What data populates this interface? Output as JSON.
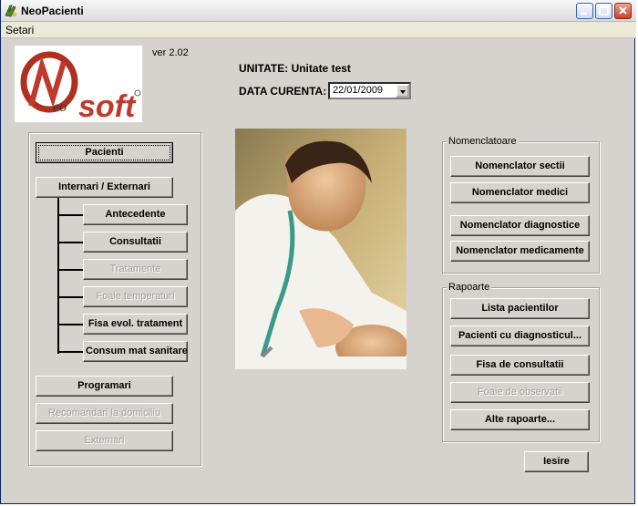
{
  "window": {
    "title": "NeoPacienti"
  },
  "menu": {
    "items": [
      "Setari"
    ]
  },
  "version_text": "ver 2.02",
  "unitate": {
    "label": "UNITATE:",
    "value": "Unitate test"
  },
  "data_curenta": {
    "label": "DATA CURENTA:",
    "value": "22/01/2009"
  },
  "left_panel": {
    "pacienti": "Pacienti",
    "internari_externari": "Internari / Externari",
    "sub_items": [
      {
        "label": "Antecedente",
        "enabled": true
      },
      {
        "label": "Consultatii",
        "enabled": true
      },
      {
        "label": "Tratamente",
        "enabled": false
      },
      {
        "label": "Foaie temperaturi",
        "enabled": false
      },
      {
        "label": "Fisa evol. tratament",
        "enabled": true
      },
      {
        "label": "Consum mat sanitare",
        "enabled": true
      }
    ],
    "programari": "Programari",
    "recomandari": "Recomandari la domiciliu",
    "externari": "Externari"
  },
  "nomenclatoare": {
    "title": "Nomenclatoare",
    "buttons": [
      "Nomenclator sectii",
      "Nomenclator medici",
      "Nomenclator diagnostice",
      "Nomenclator medicamente"
    ]
  },
  "rapoarte": {
    "title": "Rapoarte",
    "buttons": [
      {
        "label": "Lista pacientilor",
        "enabled": true
      },
      {
        "label": "Pacienti cu diagnosticul...",
        "enabled": true
      },
      {
        "label": "Fisa de consultatii",
        "enabled": true
      },
      {
        "label": "Foaie de observatii",
        "enabled": false
      },
      {
        "label": "Alte rapoarte...",
        "enabled": true
      }
    ]
  },
  "iesire": "Iesire",
  "colors": {
    "window_bg": "#d6d3ce",
    "logo_red": "#c0392b",
    "disabled_text": "#a0a0a0"
  },
  "icons": [
    "app-icon",
    "minimize-icon",
    "maximize-icon",
    "close-icon",
    "dropdown-arrow-icon"
  ]
}
